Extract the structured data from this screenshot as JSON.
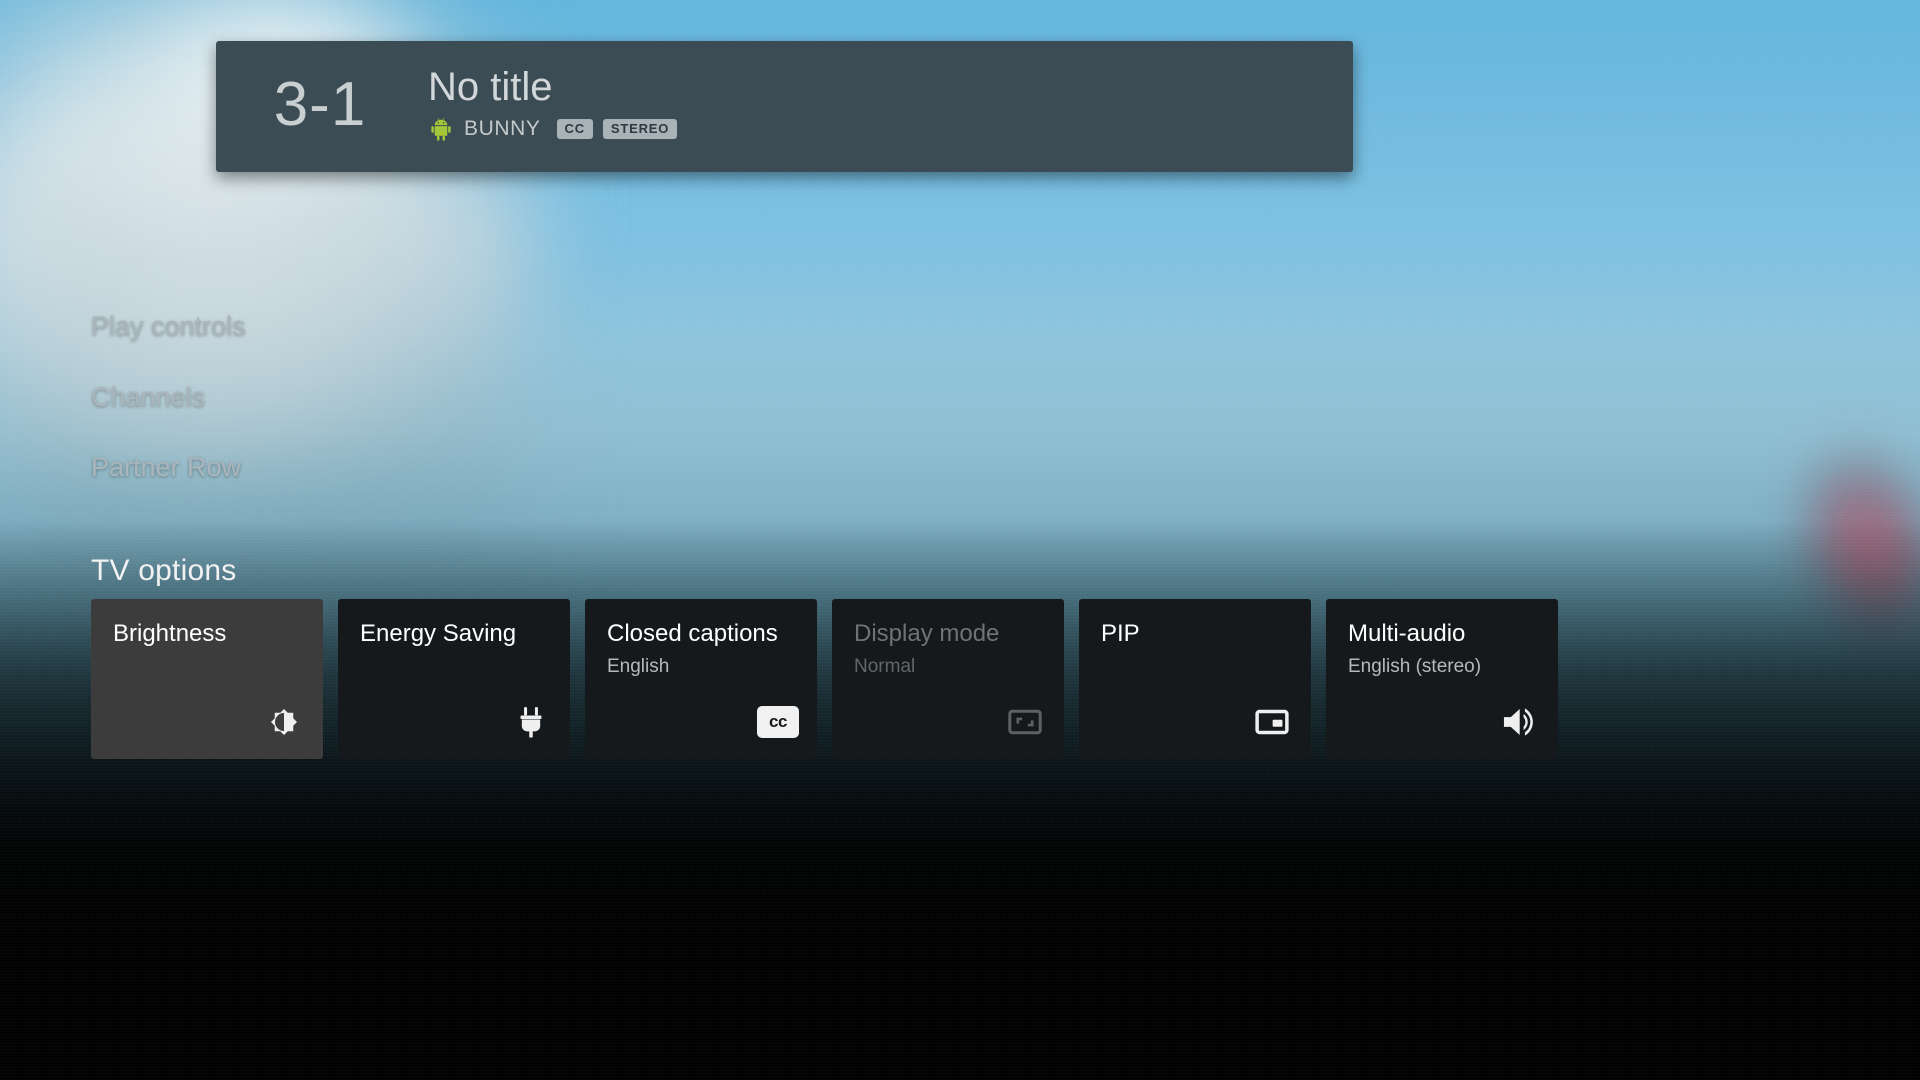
{
  "banner": {
    "channel_number": "3-1",
    "title": "No title",
    "provider": "BUNNY",
    "provider_icon": "android-robot-icon",
    "badges": [
      "CC",
      "STEREO"
    ],
    "background_color": "#3c4c54"
  },
  "rows": [
    {
      "label": "Play controls",
      "name": "row-play-controls"
    },
    {
      "label": "Channels",
      "name": "row-channels"
    },
    {
      "label": "Partner Row",
      "name": "row-partner-row"
    }
  ],
  "tv_options": {
    "heading": "TV options",
    "tiles": [
      {
        "label": "Brightness",
        "value": "",
        "icon": "brightness-icon",
        "state": "focused"
      },
      {
        "label": "Energy Saving",
        "value": "",
        "icon": "power-plug-icon",
        "state": "normal"
      },
      {
        "label": "Closed captions",
        "value": "English",
        "icon": "closed-caption-icon",
        "state": "normal"
      },
      {
        "label": "Display mode",
        "value": "Normal",
        "icon": "aspect-ratio-icon",
        "state": "disabled"
      },
      {
        "label": "PIP",
        "value": "",
        "icon": "picture-in-picture-icon",
        "state": "normal"
      },
      {
        "label": "Multi-audio",
        "value": "English (stereo)",
        "icon": "volume-up-icon",
        "state": "normal"
      }
    ]
  },
  "colors": {
    "focused_tile": "#3c3c3c",
    "tile": "#15191b",
    "badge": "#a9b2b6",
    "accent_sky": "#7ec1e2"
  }
}
